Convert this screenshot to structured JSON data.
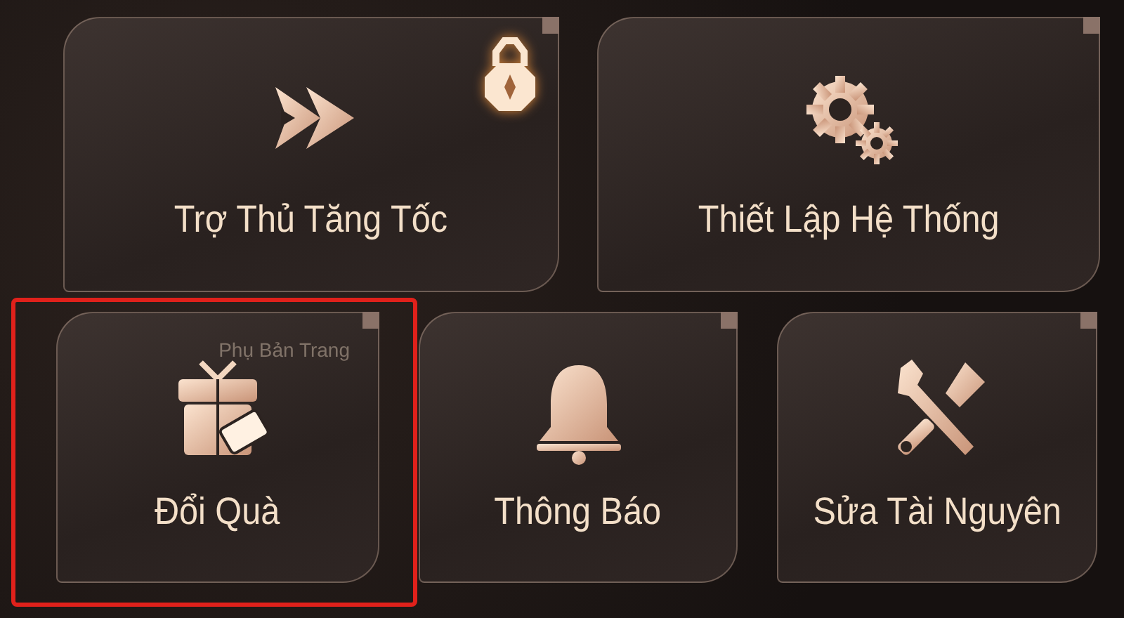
{
  "tiles": [
    {
      "label": "Trợ Thủ Tăng Tốc",
      "kind": "speed",
      "locked": true,
      "selected": false
    },
    {
      "label": "Thiết Lập Hệ Thống",
      "kind": "settings",
      "locked": false,
      "selected": false
    },
    {
      "label": "Đổi Quà",
      "kind": "gift",
      "locked": false,
      "selected": true
    },
    {
      "label": "Thông Báo",
      "kind": "bell",
      "locked": false,
      "selected": false
    },
    {
      "label": "Sửa Tài Nguyên",
      "kind": "repair",
      "locked": false,
      "selected": false
    }
  ],
  "background_label": "Phụ Bản Trang"
}
